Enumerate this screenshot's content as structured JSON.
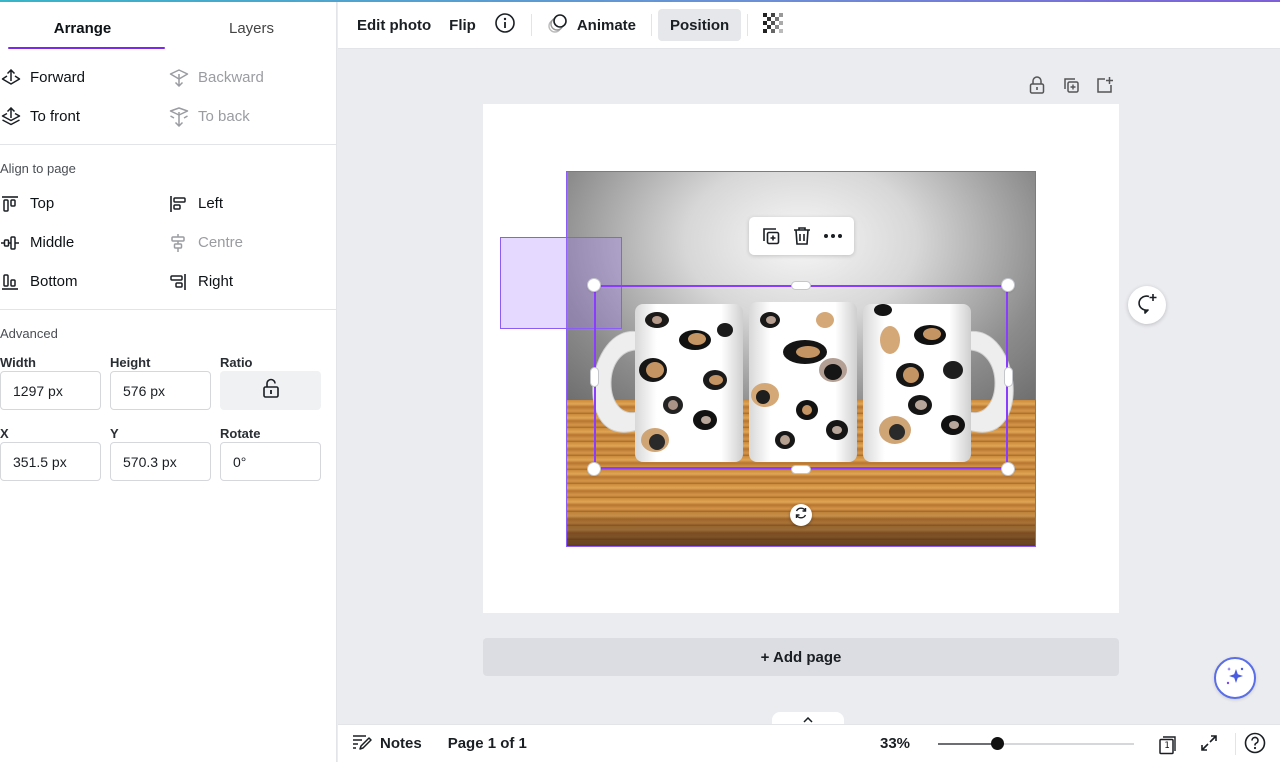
{
  "panel": {
    "tabs": [
      {
        "label": "Arrange",
        "active": true
      },
      {
        "label": "Layers",
        "active": false
      }
    ],
    "order": {
      "forward": {
        "label": "Forward",
        "icon": "forward-icon",
        "enabled": true
      },
      "backward": {
        "label": "Backward",
        "icon": "backward-icon",
        "enabled": false
      },
      "to_front": {
        "label": "To front",
        "icon": "to-front-icon",
        "enabled": true
      },
      "to_back": {
        "label": "To back",
        "icon": "to-back-icon",
        "enabled": false
      }
    },
    "align_title": "Align to page",
    "align": {
      "top": {
        "label": "Top",
        "icon": "align-top-icon",
        "enabled": true
      },
      "left": {
        "label": "Left",
        "icon": "align-left-icon",
        "enabled": true
      },
      "middle": {
        "label": "Middle",
        "icon": "align-middle-icon",
        "enabled": true
      },
      "centre": {
        "label": "Centre",
        "icon": "align-centre-icon",
        "enabled": false
      },
      "bottom": {
        "label": "Bottom",
        "icon": "align-bottom-icon",
        "enabled": true
      },
      "right": {
        "label": "Right",
        "icon": "align-right-icon",
        "enabled": true
      }
    },
    "advanced_title": "Advanced",
    "fields": {
      "width": {
        "label": "Width",
        "value": "1297 px"
      },
      "height": {
        "label": "Height",
        "value": "576 px"
      },
      "ratio": {
        "label": "Ratio",
        "icon": "unlock-icon"
      },
      "x": {
        "label": "X",
        "value": "351.5 px"
      },
      "y": {
        "label": "Y",
        "value": "570.3 px"
      },
      "rotate": {
        "label": "Rotate",
        "value": "0°"
      }
    }
  },
  "toolbar": {
    "edit_photo": "Edit photo",
    "flip": "Flip",
    "info_icon": "info-icon",
    "animate": "Animate",
    "position": "Position",
    "transparency_icon": "transparency-icon"
  },
  "page_tools": [
    "lock-icon",
    "duplicate-page-icon",
    "add-page-icon"
  ],
  "float_menu": [
    "duplicate-icon",
    "trash-icon",
    "more-icon"
  ],
  "add_page_label": "+ Add page",
  "footer": {
    "notes": "Notes",
    "page_indicator": "Page 1 of 1",
    "zoom": "33%",
    "zoom_slider_fraction": 0.3,
    "page_count_badge": "1"
  },
  "colors": {
    "accent": "#7d2ae8",
    "selection": "#8b3dff"
  }
}
